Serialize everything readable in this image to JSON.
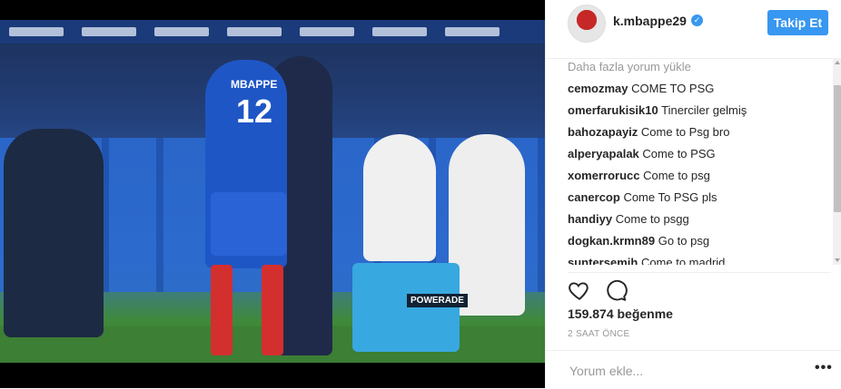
{
  "post": {
    "image_alt": "",
    "jersey_name": "MBAPPE",
    "jersey_number": "12",
    "cooler_label": "POWERADE"
  },
  "header": {
    "username": "k.mbappe29",
    "verified_icon": "verified-badge-icon",
    "follow_label": "Takip Et"
  },
  "comments": {
    "load_more": "Daha fazla yorum yükle",
    "items": [
      {
        "user": "cemozmay",
        "text": "COME TO PSG"
      },
      {
        "user": "omerfarukisik10",
        "text": "Tinerciler gelmiş"
      },
      {
        "user": "bahozapayiz",
        "text": "Come to Psg bro"
      },
      {
        "user": "alperyapalak",
        "text": "Come to PSG"
      },
      {
        "user": "xomerrorucc",
        "text": "Come to psg"
      },
      {
        "user": "canercop",
        "text": "Come To PSG pls"
      },
      {
        "user": "handiyy",
        "text": "Come to psgg"
      },
      {
        "user": "dogkan.krmn89",
        "text": "Go to psg"
      },
      {
        "user": "suntersemih",
        "text": "Come to madrid"
      }
    ]
  },
  "actions": {
    "like_icon": "heart-icon",
    "comment_icon": "comment-bubble-icon",
    "likes": "159.874 beğenme",
    "time": "2 SAAT ÖNCE"
  },
  "add_comment": {
    "placeholder": "Yorum ekle...",
    "more_icon": "more-options-icon",
    "more_glyph": "•••"
  },
  "colors": {
    "accent": "#3897f0",
    "text": "#262626",
    "muted": "#999999"
  }
}
